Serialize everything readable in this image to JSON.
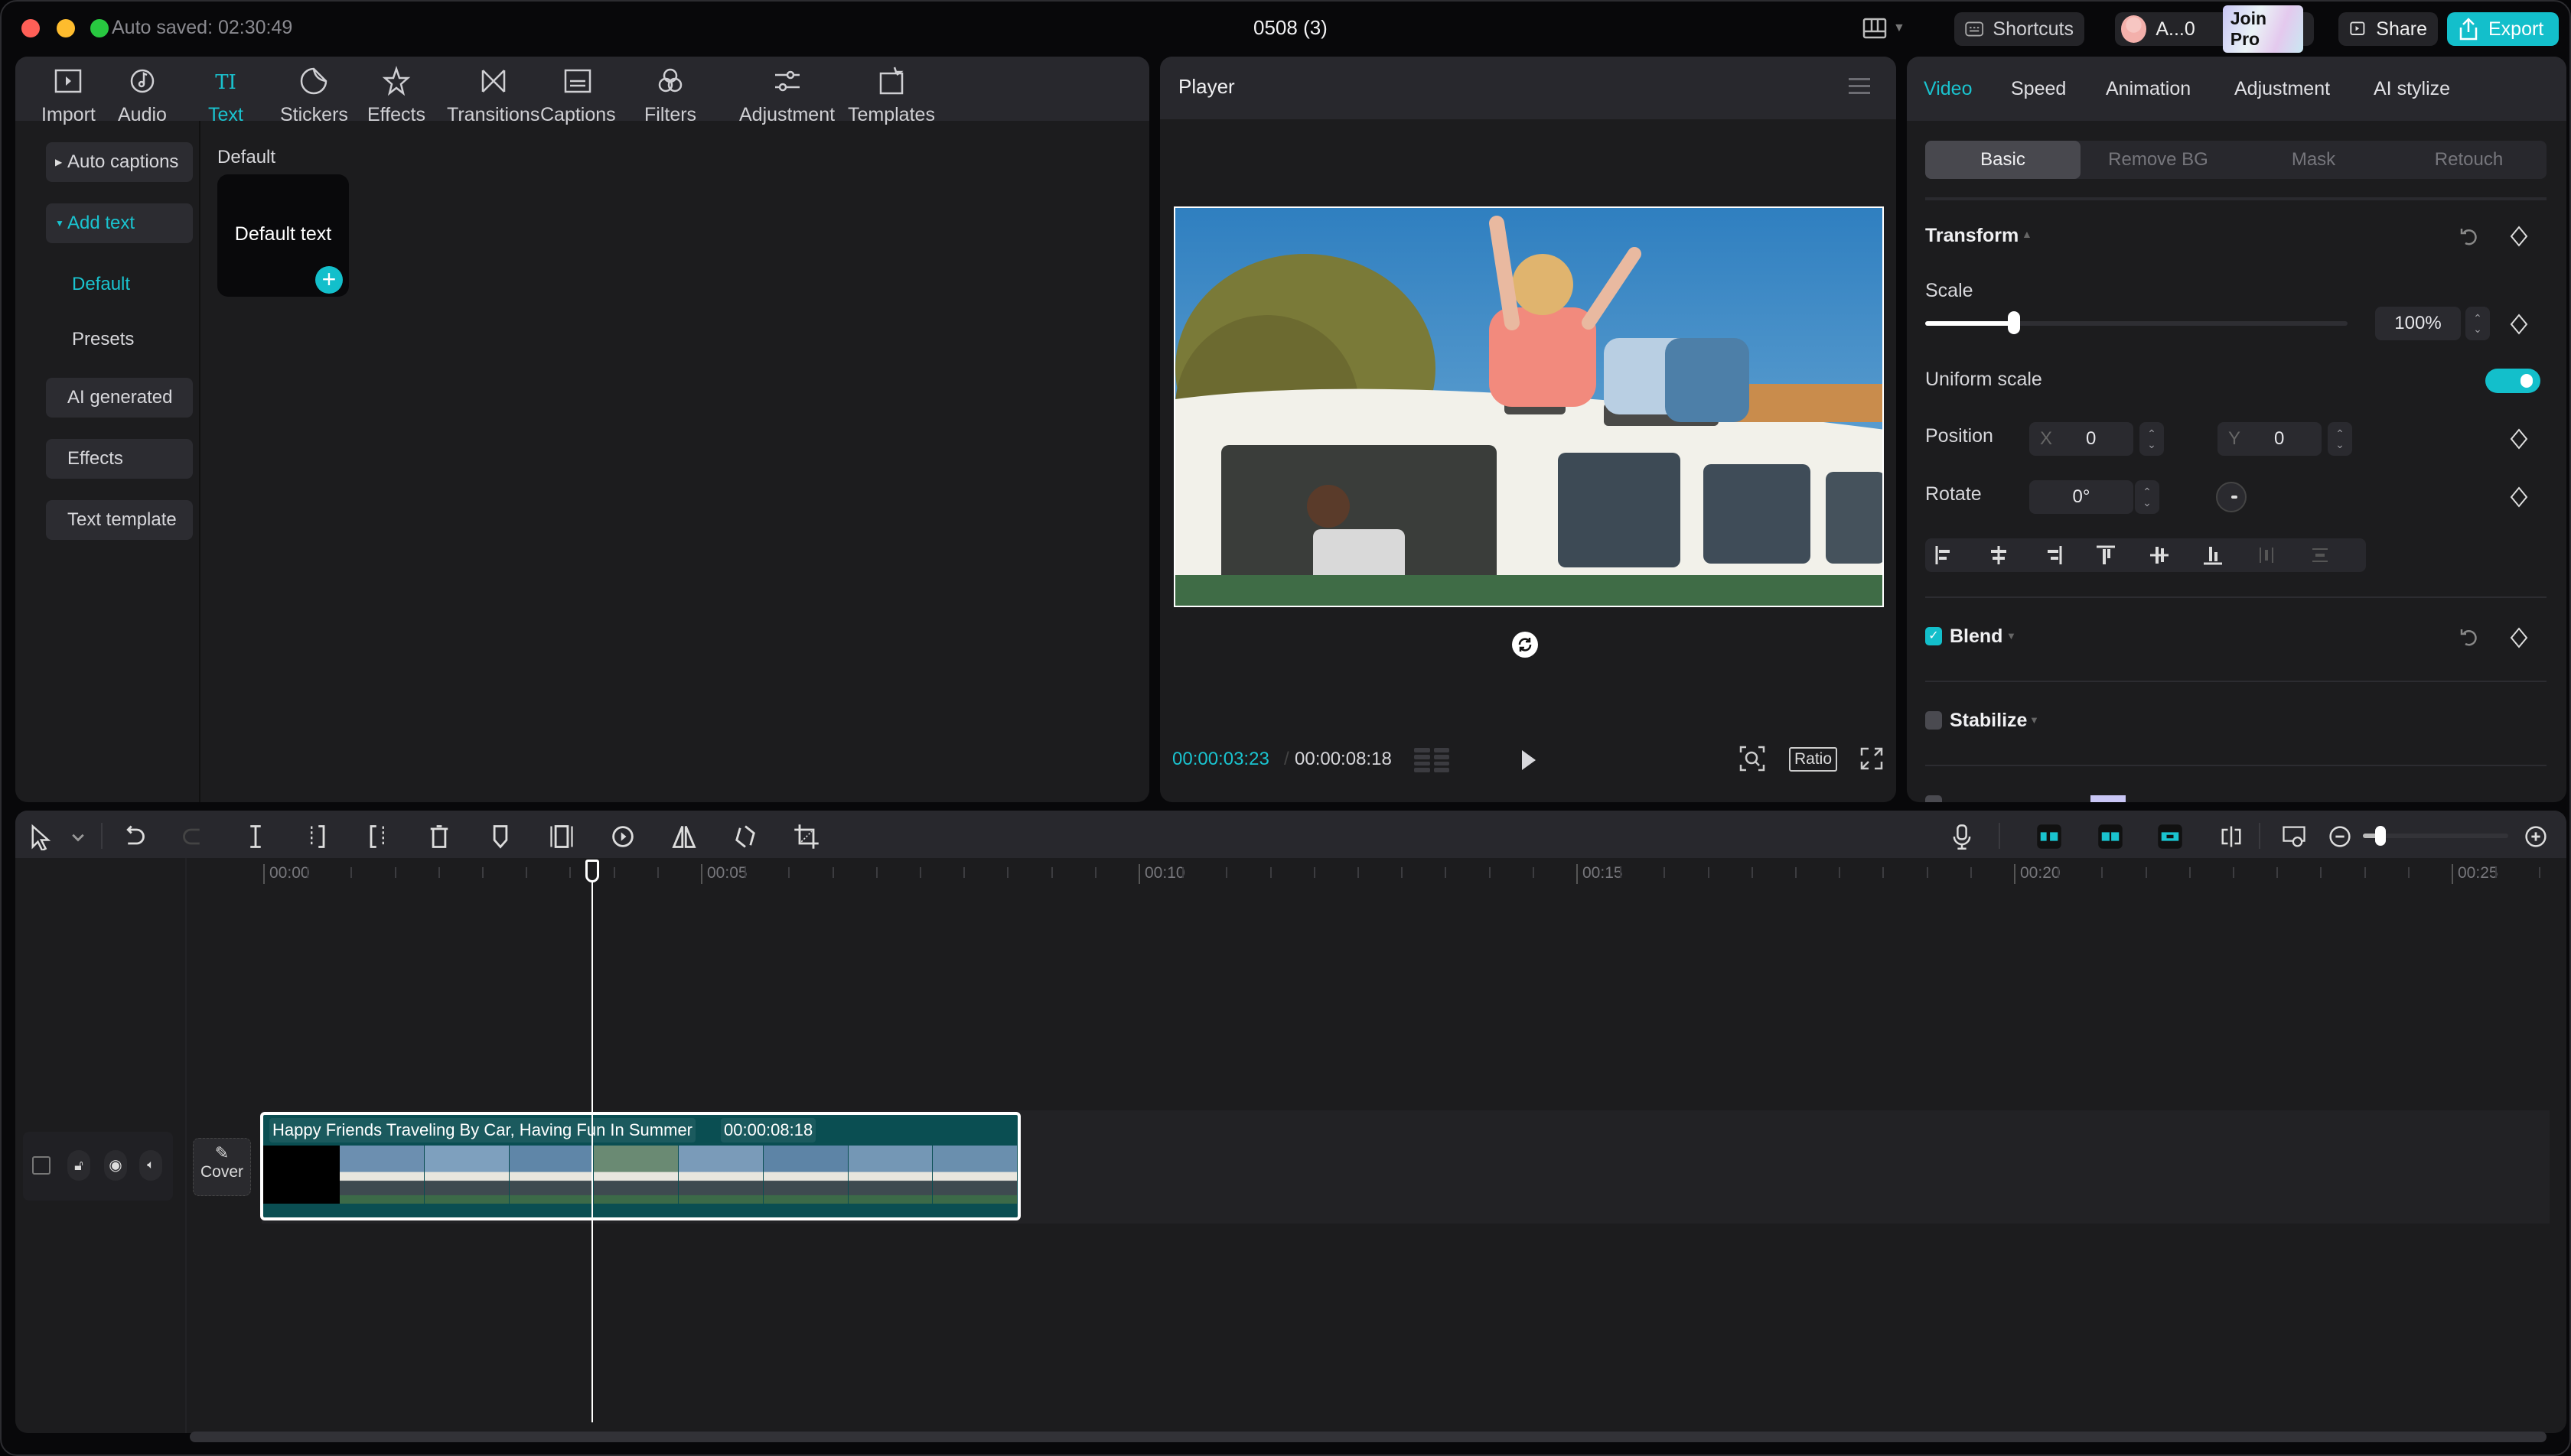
{
  "window": {
    "autosave_text": "Auto saved: 02:30:49",
    "title": "0508 (3)",
    "traffic_colors": [
      "#ff5f57",
      "#febc2e",
      "#28c840"
    ]
  },
  "header_actions": {
    "shortcuts_label": "Shortcuts",
    "account_name": "A...0",
    "join_pro_label": "Join Pro",
    "share_label": "Share",
    "export_label": "Export"
  },
  "media_tabs": [
    {
      "label": "Import",
      "icon": "import-icon"
    },
    {
      "label": "Audio",
      "icon": "audio-icon"
    },
    {
      "label": "Text",
      "icon": "text-icon",
      "active": true
    },
    {
      "label": "Stickers",
      "icon": "stickers-icon"
    },
    {
      "label": "Effects",
      "icon": "effects-icon"
    },
    {
      "label": "Transitions",
      "icon": "transitions-icon"
    },
    {
      "label": "Captions",
      "icon": "captions-icon"
    },
    {
      "label": "Filters",
      "icon": "filters-icon"
    },
    {
      "label": "Adjustment",
      "icon": "adjustment-icon"
    },
    {
      "label": "Templates",
      "icon": "templates-icon"
    }
  ],
  "text_sidebar": {
    "auto_captions": "Auto captions",
    "add_text": "Add text",
    "default": "Default",
    "presets": "Presets",
    "ai_generated": "AI generated",
    "effects": "Effects",
    "text_template": "Text template"
  },
  "text_content": {
    "section_title": "Default",
    "card_label": "Default text"
  },
  "player": {
    "title": "Player",
    "current_time": "00:00:03:23",
    "total_time": "00:00:08:18",
    "ratio_label": "Ratio"
  },
  "inspector": {
    "tabs": [
      "Video",
      "Speed",
      "Animation",
      "Adjustment",
      "AI stylize"
    ],
    "active_tab": "Video",
    "subtabs": [
      "Basic",
      "Remove BG",
      "Mask",
      "Retouch"
    ],
    "active_subtab": "Basic",
    "transform_label": "Transform",
    "scale_label": "Scale",
    "scale_value": "100%",
    "scale_slider_fraction": 0.21,
    "uniform_scale_label": "Uniform scale",
    "uniform_scale_on": true,
    "position_label": "Position",
    "pos_x_label": "X",
    "pos_x_value": "0",
    "pos_y_label": "Y",
    "pos_y_value": "0",
    "rotate_label": "Rotate",
    "rotate_value": "0°",
    "blend_label": "Blend",
    "blend_checked": true,
    "stabilize_label": "Stabilize",
    "stabilize_checked": false
  },
  "timeline": {
    "ruler_labels": [
      "00:00",
      "00:05",
      "00:10",
      "00:15",
      "00:20",
      "00:25"
    ],
    "cover_label": "Cover",
    "clip_title": "Happy Friends Traveling By Car, Having Fun In Summer",
    "clip_duration": "00:00:08:18",
    "accent": "#1ac3cf"
  }
}
